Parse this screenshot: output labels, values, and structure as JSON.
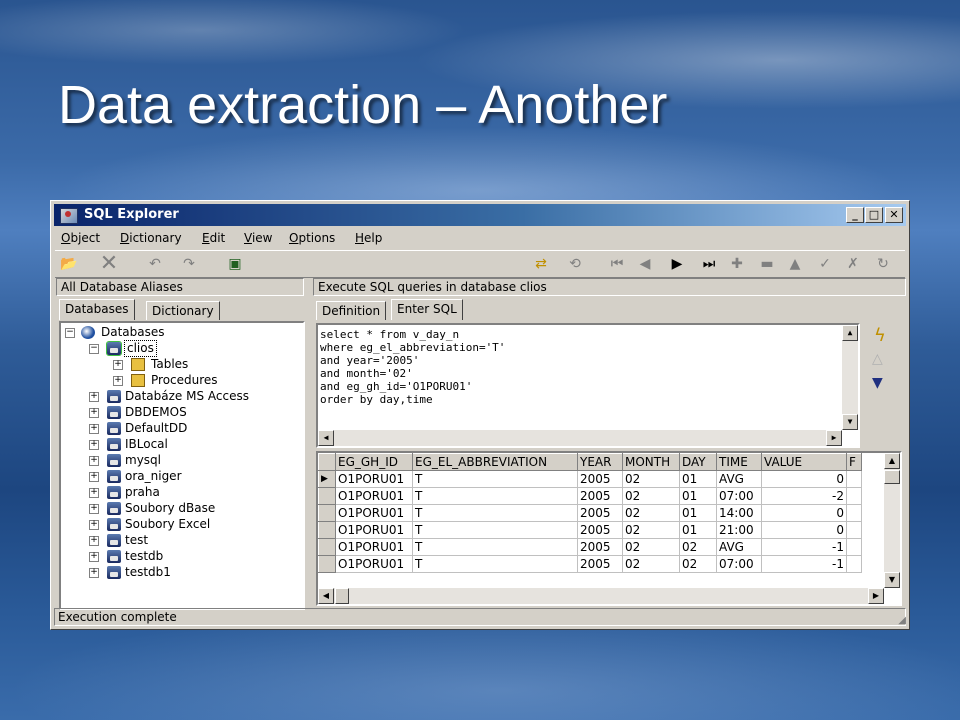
{
  "slide": {
    "title": "Data extraction – Another"
  },
  "window": {
    "title": "SQL Explorer",
    "minimize": "_",
    "maximize": "□",
    "close": "✕"
  },
  "menu": [
    "Object",
    "Dictionary",
    "Edit",
    "View",
    "Options",
    "Help"
  ],
  "toolbar_icons": [
    "open-icon",
    "cut-icon",
    "undo-icon",
    "redo-icon",
    "run-icon",
    "refresh-icon",
    "commit-icon",
    "first-icon",
    "prior-icon",
    "next-icon",
    "last-icon",
    "insert-icon",
    "delete-icon",
    "edit-icon",
    "post-icon",
    "cancel-icon",
    "refresh-data-icon"
  ],
  "left_panel": {
    "header": "All Database Aliases",
    "tabs": [
      "Databases",
      "Dictionary"
    ],
    "tree": [
      {
        "label": "Databases",
        "level": 0,
        "icon": "root",
        "expanded": true
      },
      {
        "label": "clios",
        "level": 1,
        "icon": "db-open",
        "expanded": true,
        "selected": true
      },
      {
        "label": "Tables",
        "level": 2,
        "icon": "folder"
      },
      {
        "label": "Procedures",
        "level": 2,
        "icon": "folder"
      },
      {
        "label": "Databáze MS Access",
        "level": 1,
        "icon": "db"
      },
      {
        "label": "DBDEMOS",
        "level": 1,
        "icon": "db-multi"
      },
      {
        "label": "DefaultDD",
        "level": 1,
        "icon": "db-multi"
      },
      {
        "label": "IBLocal",
        "level": 1,
        "icon": "db-multi"
      },
      {
        "label": "mysql",
        "level": 1,
        "icon": "db"
      },
      {
        "label": "ora_niger",
        "level": 1,
        "icon": "db"
      },
      {
        "label": "praha",
        "level": 1,
        "icon": "db"
      },
      {
        "label": "Soubory dBase",
        "level": 1,
        "icon": "db"
      },
      {
        "label": "Soubory Excel",
        "level": 1,
        "icon": "db"
      },
      {
        "label": "test",
        "level": 1,
        "icon": "db"
      },
      {
        "label": "testdb",
        "level": 1,
        "icon": "db"
      },
      {
        "label": "testdb1",
        "level": 1,
        "icon": "db"
      }
    ]
  },
  "right_panel": {
    "header": "Execute SQL queries in database clios",
    "tabs": [
      "Definition",
      "Enter SQL"
    ],
    "sql_lines": [
      "select * from v_day_n",
      "where eg_el_abbreviation='T'",
      "and year='2005'",
      "and month='02'",
      "and eg_gh_id='O1PORU01'",
      "order by day,time"
    ],
    "grid": {
      "columns": [
        "EG_GH_ID",
        "EG_EL_ABBREVIATION",
        "YEAR",
        "MONTH",
        "DAY",
        "TIME",
        "VALUE",
        "F"
      ],
      "rows": [
        [
          "O1PORU01",
          "T",
          "2005",
          "02",
          "01",
          "AVG",
          "0",
          ""
        ],
        [
          "O1PORU01",
          "T",
          "2005",
          "02",
          "01",
          "07:00",
          "-2",
          ""
        ],
        [
          "O1PORU01",
          "T",
          "2005",
          "02",
          "01",
          "14:00",
          "0",
          ""
        ],
        [
          "O1PORU01",
          "T",
          "2005",
          "02",
          "01",
          "21:00",
          "0",
          ""
        ],
        [
          "O1PORU01",
          "T",
          "2005",
          "02",
          "02",
          "AVG",
          "-1",
          ""
        ],
        [
          "O1PORU01",
          "T",
          "2005",
          "02",
          "02",
          "07:00",
          "-1",
          ""
        ]
      ]
    }
  },
  "status": "Execution complete",
  "colors": {
    "titlebar_start": "#0a246a",
    "titlebar_end": "#a6caf0",
    "face": "#d4d0c8"
  }
}
